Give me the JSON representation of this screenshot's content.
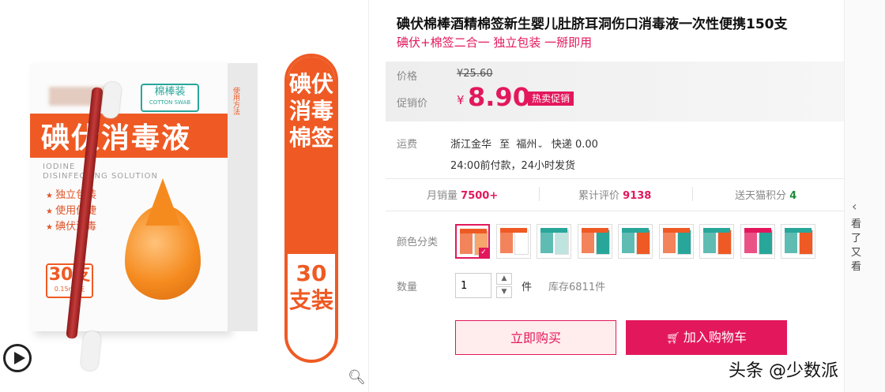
{
  "product": {
    "title": "碘伏棉棒酒精棉签新生婴儿肚脐耳洞伤口消毒液一次性便携150支",
    "subtitle": "碘伏+棉签二合一 独立包装 一掰即用"
  },
  "gallery": {
    "box_title": "碘伏消毒液",
    "brand_tag": "棉棒装",
    "brand_tag_en": "COTTON SWAB",
    "en_line1": "IODINE",
    "en_line2": "DISINFECTING SOLUTION",
    "features": [
      "独立包装",
      "使用便捷",
      "碘伏消毒"
    ],
    "count_main": "30支",
    "count_sub": "装",
    "count_note": "0.15ml/支",
    "side_label": "碘伏消毒棉签",
    "side_count": "30支装",
    "side_panel": "使用方法"
  },
  "price": {
    "price_label": "价格",
    "original": "¥25.60",
    "promo_label": "促销价",
    "currency": "¥",
    "promo_value": "8.90",
    "promo_tag": "热卖促销"
  },
  "shipping": {
    "label": "运费",
    "from": "浙江金华",
    "to_word": "至",
    "to_city": "福州",
    "method": "快递 0.00",
    "note": "24:00前付款，24小时发货"
  },
  "stats": {
    "monthly_label": "月销量",
    "monthly_value": "7500+",
    "reviews_label": "累计评价",
    "reviews_value": "9138",
    "points_label": "送天猫积分",
    "points_value": "4"
  },
  "options": {
    "color_label": "颜色分类",
    "swatches": 9,
    "selected_index": 0
  },
  "quantity": {
    "label": "数量",
    "value": "1",
    "unit": "件",
    "stock": "库存6811件"
  },
  "actions": {
    "buy_now": "立即购买",
    "add_to_cart": "加入购物车"
  },
  "side_rail": {
    "text": "看了又看"
  },
  "watermark": "头条 @少数派",
  "colors": {
    "accent": "#e3185c",
    "package_orange": "#ef5a24",
    "price_bg": "#f2f2f2"
  }
}
